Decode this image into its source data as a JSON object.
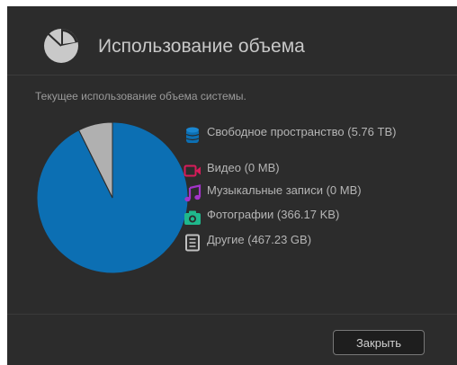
{
  "dialog": {
    "title": "Использование объема",
    "subtitle": "Текущее использование объема системы.",
    "close_label": "Закрыть"
  },
  "legend": [
    {
      "icon": "database-icon",
      "label": "Свободное пространство (5.76 TB)",
      "color": "#0c6fb3"
    },
    {
      "icon": "video-camera-icon",
      "label": "Видео (0 MB)",
      "color": "#d81b5a"
    },
    {
      "icon": "music-note-icon",
      "label": "Музыкальные записи (0 MB)",
      "color": "#a334c9"
    },
    {
      "icon": "camera-icon",
      "label": "Фотографии (366.17 KB)",
      "color": "#1fb88c"
    },
    {
      "icon": "document-icon",
      "label": "Другие (467.23 GB)",
      "color": "#c0c0c0"
    }
  ],
  "chart_data": {
    "type": "pie",
    "slices": [
      {
        "label": "Свободное пространство",
        "value": 5898.24,
        "unit": "GB",
        "color": "#0c6fb3"
      },
      {
        "label": "Видео",
        "value": 0,
        "unit": "GB",
        "color": "#d81b5a"
      },
      {
        "label": "Музыкальные записи",
        "value": 0,
        "unit": "GB",
        "color": "#a334c9"
      },
      {
        "label": "Фотографии",
        "value": 0.00035,
        "unit": "GB",
        "color": "#1fb88c"
      },
      {
        "label": "Другие",
        "value": 467.23,
        "unit": "GB",
        "color": "#b0b0b0"
      }
    ]
  }
}
